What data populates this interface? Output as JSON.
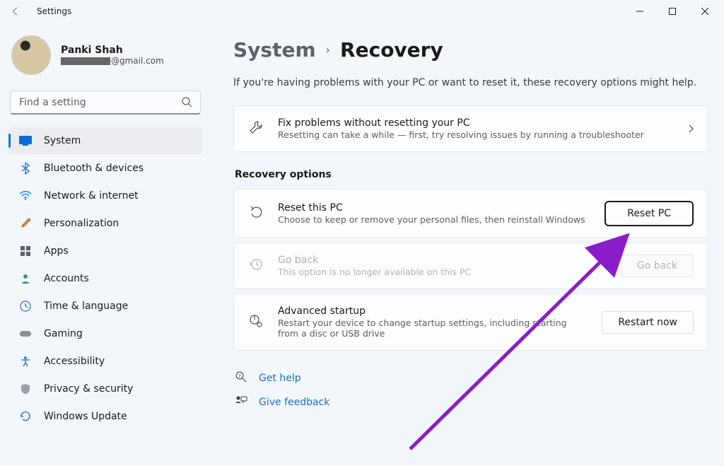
{
  "window": {
    "title": "Settings"
  },
  "account": {
    "name": "Panki Shah",
    "email_suffix": "@gmail.com"
  },
  "search": {
    "placeholder": "Find a setting"
  },
  "nav": [
    {
      "label": "System"
    },
    {
      "label": "Bluetooth & devices"
    },
    {
      "label": "Network & internet"
    },
    {
      "label": "Personalization"
    },
    {
      "label": "Apps"
    },
    {
      "label": "Accounts"
    },
    {
      "label": "Time & language"
    },
    {
      "label": "Gaming"
    },
    {
      "label": "Accessibility"
    },
    {
      "label": "Privacy & security"
    },
    {
      "label": "Windows Update"
    }
  ],
  "breadcrumb": {
    "parent": "System",
    "current": "Recovery"
  },
  "intro": "If you're having problems with your PC or want to reset it, these recovery options might help.",
  "fixCard": {
    "title": "Fix problems without resetting your PC",
    "desc": "Resetting can take a while — first, try resolving issues by running a troubleshooter"
  },
  "sectionLabel": "Recovery options",
  "resetCard": {
    "title": "Reset this PC",
    "desc": "Choose to keep or remove your personal files, then reinstall Windows",
    "button": "Reset PC"
  },
  "goBackCard": {
    "title": "Go back",
    "desc": "This option is no longer available on this PC",
    "button": "Go back"
  },
  "advancedCard": {
    "title": "Advanced startup",
    "desc": "Restart your device to change startup settings, including starting from a disc or USB drive",
    "button": "Restart now"
  },
  "help": {
    "getHelp": "Get help",
    "feedback": "Give feedback"
  }
}
